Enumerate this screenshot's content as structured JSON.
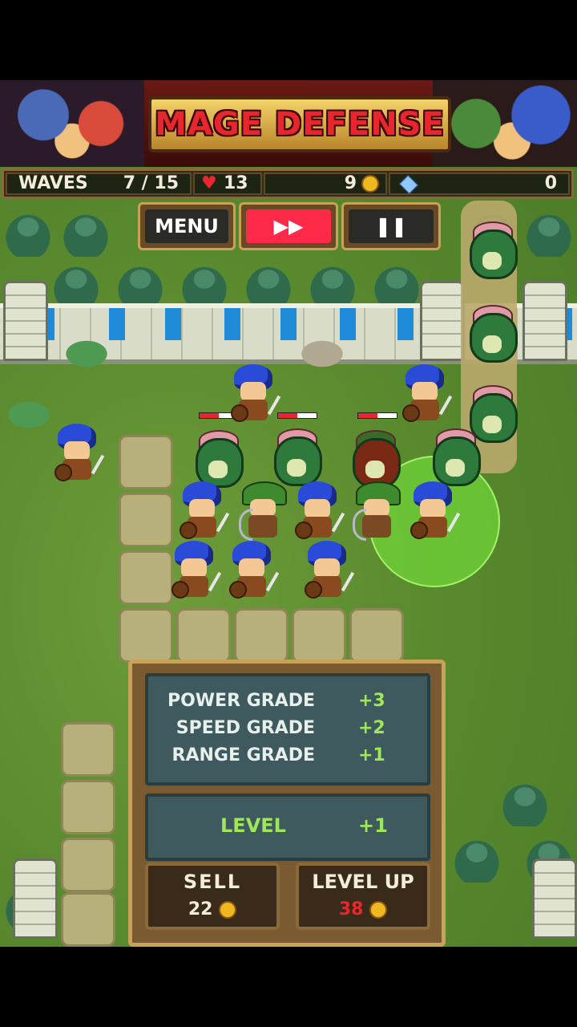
{
  "title": "MAGE DEFENSE",
  "hud": {
    "waves_label": "WAVES",
    "waves_value": "7 / 15",
    "lives": "13",
    "gold": "9",
    "gems": "0"
  },
  "controls": {
    "menu_label": "MENU",
    "fast_forward_icon": "fast-forward-icon",
    "pause_icon": "pause-icon"
  },
  "upgrade_panel": {
    "stats": [
      {
        "label": "POWER GRADE",
        "value": "+3"
      },
      {
        "label": "SPEED GRADE",
        "value": "+2"
      },
      {
        "label": "RANGE GRADE",
        "value": "+1"
      }
    ],
    "level_label": "LEVEL",
    "level_value": "+1",
    "sell_label": "SELL",
    "sell_price": "22",
    "level_up_label": "LEVEL UP",
    "level_up_price": "38"
  },
  "colors": {
    "accent_red": "#e8262e",
    "grade_green": "#9ee65a",
    "gold": "#f0b820",
    "price_unaffordable": "#e8262e"
  },
  "enemy_health_fraction": [
    0.5,
    0.5,
    0.5
  ]
}
